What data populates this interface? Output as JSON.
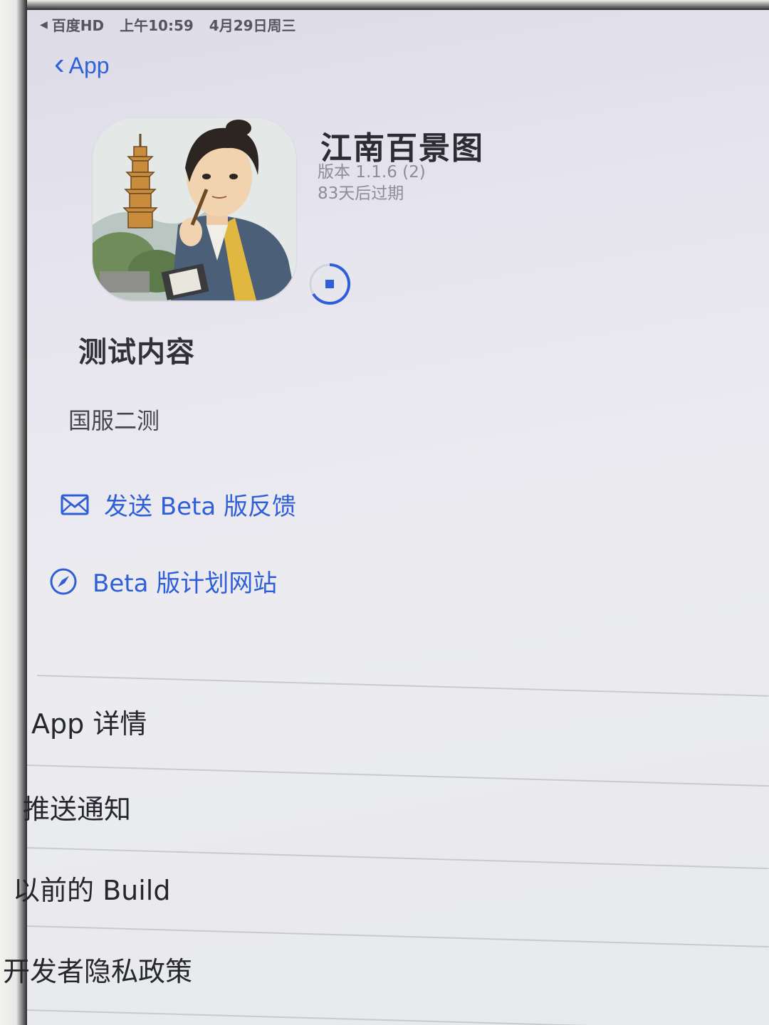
{
  "status_bar": {
    "carrier": "百度HD",
    "time": "上午10:59",
    "date": "4月29日周三"
  },
  "nav": {
    "back_label": "App"
  },
  "app": {
    "name": "江南百景图",
    "version": "版本 1.1.6 (2)",
    "expiry": "83天后过期",
    "icon": "app-artwork-icon"
  },
  "test_content": {
    "title": "测试内容",
    "body": "国服二测"
  },
  "links": {
    "feedback_label": "发送 Beta 版反馈",
    "feedback_icon": "mail-icon",
    "website_label": "Beta 版计划网站",
    "website_icon": "compass-icon"
  },
  "list": {
    "items": [
      "App 详情",
      "推送通知",
      "以前的 Build",
      "开发者隐私政策"
    ]
  },
  "colors": {
    "accent": "#2f5fd6"
  }
}
